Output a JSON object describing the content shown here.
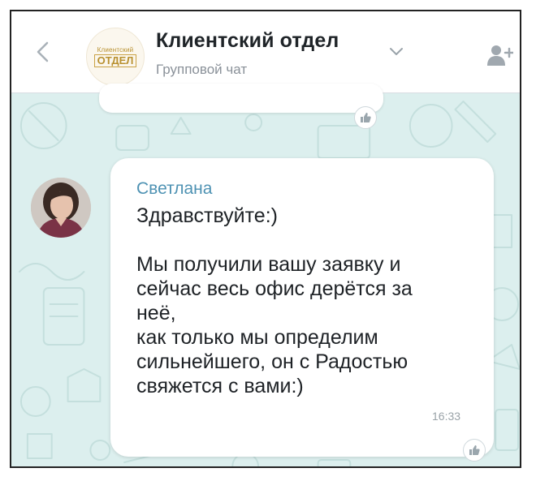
{
  "header": {
    "logo_top": "Клиентский",
    "logo_bottom": "ОТДЕЛ",
    "title": "Клиентский отдел",
    "subtitle": "Групповой чат"
  },
  "message": {
    "sender": "Светлана",
    "text": "Здравствуйте:)\n\nМы получили вашу заявку и\nсейчас весь офис дерётся за\nнеё,\nкак только мы определим\nсильнейшего, он с Радостью\nсвяжется с вами:)",
    "time": "16:33"
  },
  "colors": {
    "chat_background": "#dcefee",
    "sender_name": "#4e92b3",
    "logo_gold": "#b8902f"
  },
  "icons": [
    "back-icon",
    "chevron-down-icon",
    "add-user-icon",
    "like-icon"
  ]
}
